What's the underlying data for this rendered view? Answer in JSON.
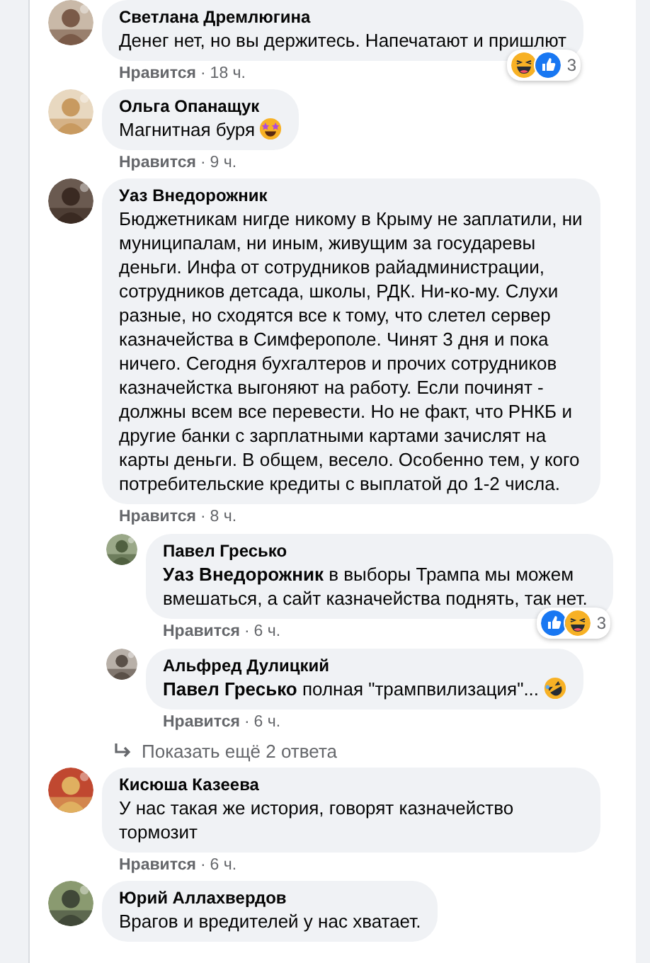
{
  "comments": [
    {
      "author": "Светлана Дремлюгина",
      "text": "Денег нет, но вы держитесь. Напечатают и пришлют",
      "like": "Нравится",
      "separator": "·",
      "time": "18 ч.",
      "reactions": [
        {
          "kind": "haha"
        },
        {
          "kind": "like"
        }
      ],
      "reaction_count": "3"
    },
    {
      "author": "Ольга Опанащук",
      "text": "Магнитная буря",
      "emoji": {
        "kind": "star_struck"
      },
      "like": "Нравится",
      "separator": "·",
      "time": "9 ч."
    },
    {
      "author": "Уаз Внедорожник",
      "text": "Бюджетникам нигде никому в Крыму не заплатили, ни муниципалам, ни иным, живущим за государевы деньги. Инфа от сотрудников райадминистрации, сотрудников детсада, школы, РДК. Ни-ко-му. Слухи разные, но сходятся все к тому, что слетел сервер казначейства в Симферополе. Чинят 3 дня и пока ничего. Сегодня бухгалтеров и прочих сотрудников казначейстка выгоняют на работу. Если починят - должны всем все перевести. Но не факт, что РНКБ и другие банки с зарплатными картами зачислят на карты деньги. В общем, весело. Особенно тем, у кого потребительские кредиты с выплатой до 1-2 числа.",
      "like": "Нравится",
      "separator": "·",
      "time": "8 ч.",
      "replies": [
        {
          "author": "Павел Гресько",
          "text": "**Уаз Внедорожник** в выборы Трампа мы можем вмешаться, а сайт казначейства поднять, так нет.",
          "like": "Нравится",
          "separator": "·",
          "time": "6 ч.",
          "reactions": [
            {
              "kind": "like"
            },
            {
              "kind": "haha"
            }
          ],
          "reaction_count": "3"
        },
        {
          "author": "Альфред Дулицкий",
          "text": "**Павел Гресько** полная \"трампвилизация\"...",
          "emoji": {
            "kind": "rofl"
          },
          "like": "Нравится",
          "separator": "·",
          "time": "6 ч."
        }
      ],
      "more_replies": "Показать ещё 2 ответа"
    },
    {
      "author": "Кисюша Казеева",
      "text": "У нас такая же история, говорят казначейство тормозит",
      "like": "Нравится",
      "separator": "·",
      "time": "6 ч."
    },
    {
      "author": "Юрий Аллахвердов",
      "text": "Врагов и вредителей у нас хватает."
    }
  ]
}
